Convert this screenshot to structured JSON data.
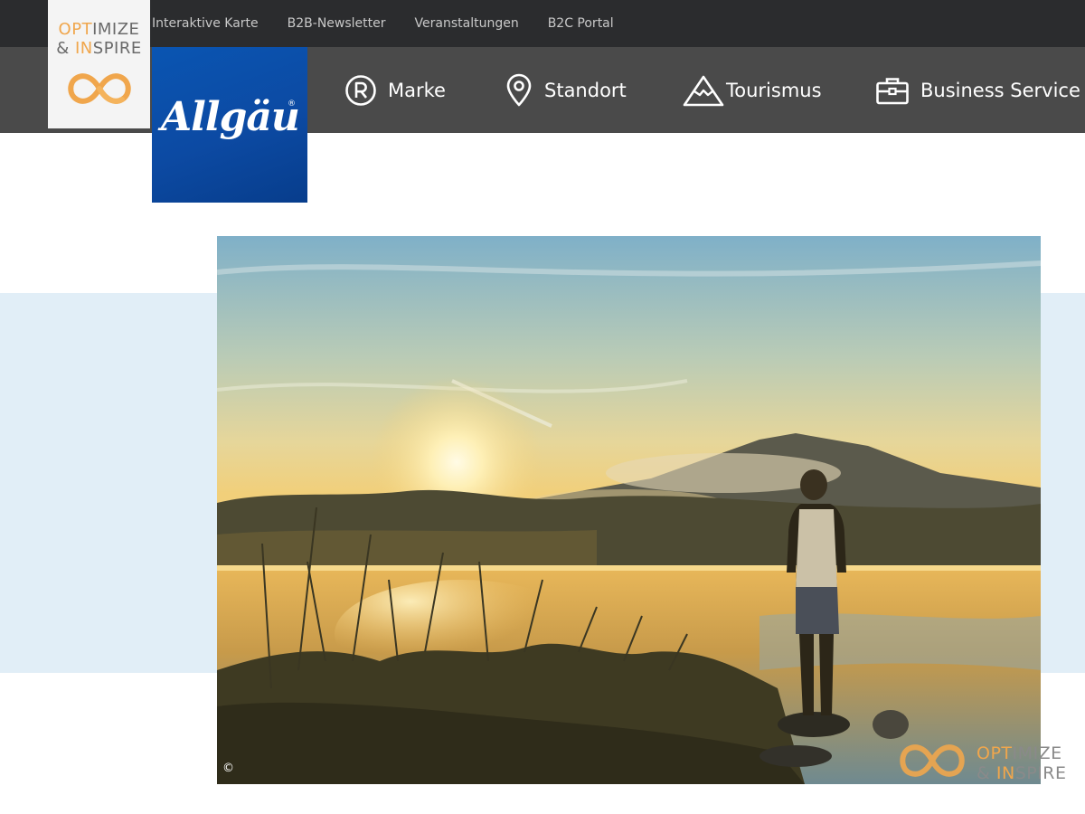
{
  "topbar": {
    "links": [
      "Interaktive Karte",
      "B2B-Newsletter",
      "Veranstaltungen",
      "B2C Portal"
    ]
  },
  "branding": {
    "optimize_part1": "OPT",
    "optimize_part2": "IMIZE",
    "inspire_part1": "& IN",
    "inspire_part2": "SPIRE",
    "accent_color": "#f0a64c",
    "logo_text": "Allgäu",
    "logo_mark": "®",
    "logo_color": "#0a55b2"
  },
  "nav": {
    "items": [
      {
        "label": "Marke",
        "icon": "registered-icon"
      },
      {
        "label": "Standort",
        "icon": "location-pin-icon"
      },
      {
        "label": "Tourismus",
        "icon": "mountain-icon"
      },
      {
        "label": "Business Service",
        "icon": "briefcase-icon"
      }
    ]
  },
  "hero": {
    "copyright": "©"
  },
  "watermark": {
    "line1_a": "OPT",
    "line1_b": "IMIZE",
    "line2_a": "& IN",
    "line2_b": "SPIRE"
  }
}
